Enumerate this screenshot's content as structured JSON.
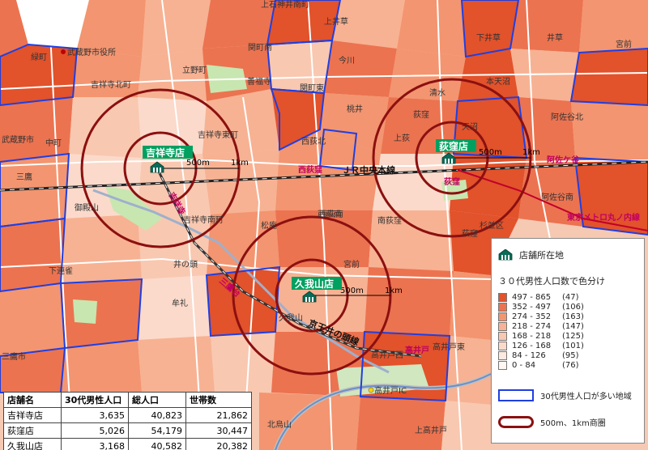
{
  "map": {
    "area_labels": [
      "上石神井南町",
      "上井草",
      "関町南",
      "今川",
      "関町東",
      "善福寺",
      "桃井",
      "清水",
      "本天沼",
      "下井草",
      "井草",
      "緑町",
      "武蔵野市役所",
      "吉祥寺北町",
      "立野町",
      "西荻北",
      "上荻",
      "天沼",
      "阿佐谷北",
      "吉祥寺東町",
      "武蔵野市",
      "中町",
      "三鷹",
      "西荻南",
      "御殿山",
      "吉祥寺南町",
      "松庵",
      "西荻南",
      "南荻窪",
      "荻窪",
      "阿佐谷南",
      "杉並区",
      "下連雀",
      "井の頭",
      "宮前",
      "牟礼",
      "久我山",
      "高井戸西",
      "高井戸東",
      "三鷹市",
      "高井戸IC",
      "北烏山",
      "上高井戸",
      "宮前",
      "荻窪"
    ],
    "line_labels": [
      "吉祥寺",
      "西荻窪",
      "荻窪",
      "阿佐ケ谷",
      "三鷹台",
      "高井戸",
      "東京メトロ丸ノ内線"
    ],
    "rail_labels": [
      "ＪＲ中央本線",
      "京王井の頭線"
    ],
    "distance_labels": [
      "500m",
      "1km"
    ],
    "stores": [
      {
        "name": "吉祥寺店"
      },
      {
        "name": "荻窪店"
      },
      {
        "name": "久我山店"
      }
    ]
  },
  "legend": {
    "store_location": "店舗所在地",
    "title": "３０代男性人口数で色分け",
    "classes": [
      {
        "range": "497 - 865",
        "count": "(47)",
        "color": "#e2522b"
      },
      {
        "range": "352 - 497",
        "count": "(106)",
        "color": "#ec7350"
      },
      {
        "range": "274 - 352",
        "count": "(163)",
        "color": "#f39570"
      },
      {
        "range": "218 - 274",
        "count": "(147)",
        "color": "#f7b293"
      },
      {
        "range": "168 - 218",
        "count": "(125)",
        "color": "#f9c8b0"
      },
      {
        "range": "126 - 168",
        "count": "(101)",
        "color": "#fbdacb"
      },
      {
        "range": "84 - 126",
        "count": "(95)",
        "color": "#fde9df"
      },
      {
        "range": "0 - 84",
        "count": "(76)",
        "color": "#fff6f1"
      }
    ],
    "blue_outline": "30代男性人口が多い地域",
    "red_ring": "500m、1km商圏"
  },
  "table": {
    "headers": [
      "店舗名",
      "30代男性人口",
      "総人口",
      "世帯数"
    ],
    "rows": [
      [
        "吉祥寺店",
        "3,635",
        "40,823",
        "21,862"
      ],
      [
        "荻窪店",
        "5,026",
        "54,179",
        "30,447"
      ],
      [
        "久我山店",
        "3,168",
        "40,582",
        "20,382"
      ]
    ]
  },
  "colors": {
    "blue_boundary": "#1f3fe0",
    "ring": "#8b1010",
    "store_label_bg": "#00a060",
    "road": "#ffffff",
    "line_label": "#c00060"
  }
}
